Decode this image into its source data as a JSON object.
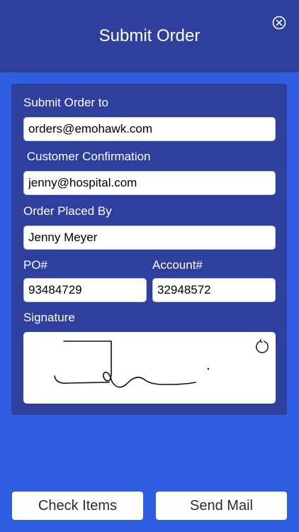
{
  "header": {
    "title": "Submit Order",
    "close_icon": "close-circle-icon"
  },
  "form": {
    "submit_to": {
      "label": "Submit Order to",
      "value": "orders@emohawk.com"
    },
    "customer_confirmation": {
      "label": " Customer Confirmation",
      "value": "jenny@hospital.com"
    },
    "order_placed_by": {
      "label": "Order Placed By",
      "value": "Jenny Meyer"
    },
    "po": {
      "label": "PO#",
      "value": "93484729"
    },
    "account": {
      "label": "Account#",
      "value": "32948572"
    },
    "signature": {
      "label": "Signature",
      "clear_icon": "refresh-icon"
    }
  },
  "footer": {
    "check_items_label": "Check Items",
    "send_mail_label": "Send Mail"
  },
  "colors": {
    "background": "#2f5ee0",
    "header": "#2e3f9e",
    "panel": "#2e3f9e",
    "field": "#ffffff"
  }
}
